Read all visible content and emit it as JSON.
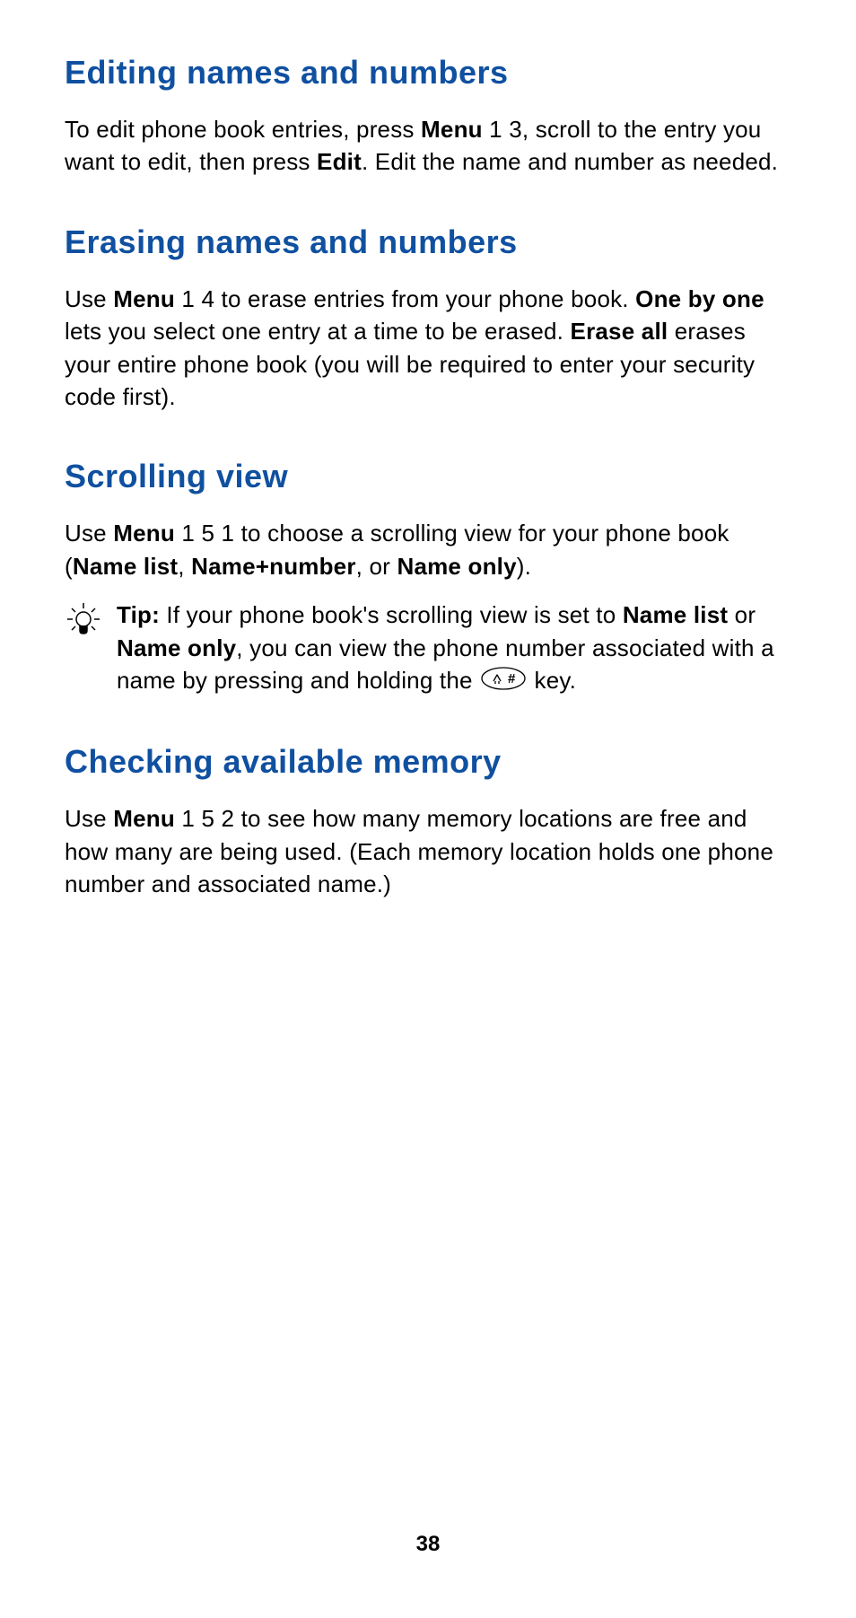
{
  "sections": {
    "editing": {
      "heading": "Editing names and numbers",
      "p1_a": "To edit phone book entries, press ",
      "p1_b": "Menu",
      "p1_c": " 1 3, scroll to the entry you want to edit, then press ",
      "p1_d": "Edit",
      "p1_e": ". Edit the name and number as needed."
    },
    "erasing": {
      "heading": "Erasing names and numbers",
      "p1_a": "Use ",
      "p1_b": "Menu",
      "p1_c": " 1 4 to erase entries from your phone book. ",
      "p1_d": "One by one",
      "p1_e": " lets you select one entry at a time to be erased. ",
      "p1_f": "Erase all",
      "p1_g": " erases your entire phone book (you will be required to enter your security code first)."
    },
    "scrolling": {
      "heading": "Scrolling view",
      "p1_a": "Use ",
      "p1_b": "Menu",
      "p1_c": " 1 5 1 to choose a scrolling view for your phone book (",
      "p1_d": "Name list",
      "p1_e": ", ",
      "p1_f": "Name+number",
      "p1_g": ", or ",
      "p1_h": "Name only",
      "p1_i": ").",
      "tip_label": "Tip:",
      "tip_a": "  If your phone book's scrolling view is set to ",
      "tip_b": "Name list",
      "tip_c": " or ",
      "tip_d": "Name only",
      "tip_e": ", you can view the phone number associated with a name by pressing and holding the ",
      "tip_f": " key."
    },
    "memory": {
      "heading": "Checking available memory",
      "p1_a": "Use ",
      "p1_b": "Menu",
      "p1_c": " 1 5 2 to see how many memory locations are free and how many are being used. (Each memory location holds one phone number and associated name.)"
    }
  },
  "page_number": "38"
}
